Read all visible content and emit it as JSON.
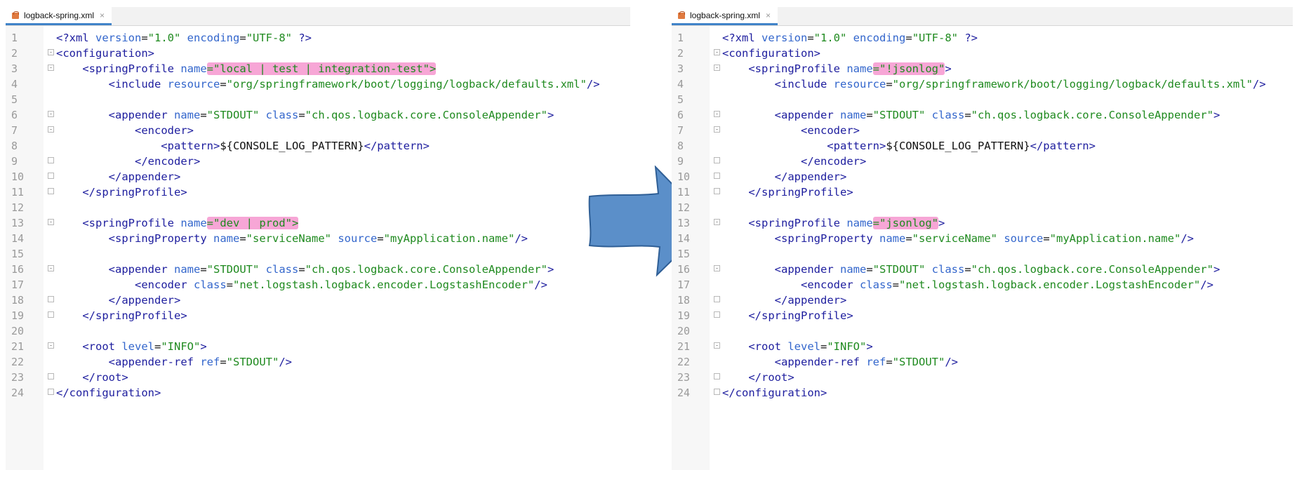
{
  "left_panel": {
    "tab": {
      "filename": "logback-spring.xml",
      "close": "×"
    },
    "lines": [
      [
        {
          "t": "<?",
          "c": "tg"
        },
        {
          "t": "xml",
          "c": "tg"
        },
        {
          "t": " version",
          "c": "at"
        },
        {
          "t": "=",
          "c": "tx"
        },
        {
          "t": "\"1.0\"",
          "c": "vl"
        },
        {
          "t": " encoding",
          "c": "at"
        },
        {
          "t": "=",
          "c": "tx"
        },
        {
          "t": "\"UTF-8\"",
          "c": "vl"
        },
        {
          "t": " ?>",
          "c": "tg"
        }
      ],
      [
        {
          "t": "<",
          "c": "tg"
        },
        {
          "t": "configuration",
          "c": "tg"
        },
        {
          "t": ">",
          "c": "tg"
        }
      ],
      [
        {
          "t": "    <",
          "c": "tg"
        },
        {
          "t": "springProfile",
          "c": "tg"
        },
        {
          "t": " name",
          "c": "at"
        },
        {
          "t": "=\"local | test | integration-test\">",
          "c": "vl",
          "hl": true
        }
      ],
      [
        {
          "t": "        <",
          "c": "tg"
        },
        {
          "t": "include",
          "c": "tg"
        },
        {
          "t": " resource",
          "c": "at"
        },
        {
          "t": "=",
          "c": "tx"
        },
        {
          "t": "\"org/springframework/boot/logging/logback/defaults.xml\"",
          "c": "vl"
        },
        {
          "t": "/>",
          "c": "tg"
        }
      ],
      [],
      [
        {
          "t": "        <",
          "c": "tg"
        },
        {
          "t": "appender",
          "c": "tg"
        },
        {
          "t": " name",
          "c": "at"
        },
        {
          "t": "=",
          "c": "tx"
        },
        {
          "t": "\"STDOUT\"",
          "c": "vl"
        },
        {
          "t": " class",
          "c": "at"
        },
        {
          "t": "=",
          "c": "tx"
        },
        {
          "t": "\"ch.qos.logback.core.ConsoleAppender\"",
          "c": "vl"
        },
        {
          "t": ">",
          "c": "tg"
        }
      ],
      [
        {
          "t": "            <",
          "c": "tg"
        },
        {
          "t": "encoder",
          "c": "tg"
        },
        {
          "t": ">",
          "c": "tg"
        }
      ],
      [
        {
          "t": "                <",
          "c": "tg"
        },
        {
          "t": "pattern",
          "c": "tg"
        },
        {
          "t": ">",
          "c": "tg"
        },
        {
          "t": "${CONSOLE_LOG_PATTERN}",
          "c": "tx"
        },
        {
          "t": "</",
          "c": "tg"
        },
        {
          "t": "pattern",
          "c": "tg"
        },
        {
          "t": ">",
          "c": "tg"
        }
      ],
      [
        {
          "t": "            </",
          "c": "tg"
        },
        {
          "t": "encoder",
          "c": "tg"
        },
        {
          "t": ">",
          "c": "tg"
        }
      ],
      [
        {
          "t": "        </",
          "c": "tg"
        },
        {
          "t": "appender",
          "c": "tg"
        },
        {
          "t": ">",
          "c": "tg"
        }
      ],
      [
        {
          "t": "    </",
          "c": "tg"
        },
        {
          "t": "springProfile",
          "c": "tg"
        },
        {
          "t": ">",
          "c": "tg"
        }
      ],
      [],
      [
        {
          "t": "    <",
          "c": "tg"
        },
        {
          "t": "springProfile",
          "c": "tg"
        },
        {
          "t": " name",
          "c": "at"
        },
        {
          "t": "=\"dev | prod\">",
          "c": "vl",
          "hl": true
        }
      ],
      [
        {
          "t": "        <",
          "c": "tg"
        },
        {
          "t": "springProperty",
          "c": "tg"
        },
        {
          "t": " name",
          "c": "at"
        },
        {
          "t": "=",
          "c": "tx"
        },
        {
          "t": "\"serviceName\"",
          "c": "vl"
        },
        {
          "t": " source",
          "c": "at"
        },
        {
          "t": "=",
          "c": "tx"
        },
        {
          "t": "\"myApplication.name\"",
          "c": "vl"
        },
        {
          "t": "/>",
          "c": "tg"
        }
      ],
      [],
      [
        {
          "t": "        <",
          "c": "tg"
        },
        {
          "t": "appender",
          "c": "tg"
        },
        {
          "t": " name",
          "c": "at"
        },
        {
          "t": "=",
          "c": "tx"
        },
        {
          "t": "\"STDOUT\"",
          "c": "vl"
        },
        {
          "t": " class",
          "c": "at"
        },
        {
          "t": "=",
          "c": "tx"
        },
        {
          "t": "\"ch.qos.logback.core.ConsoleAppender\"",
          "c": "vl"
        },
        {
          "t": ">",
          "c": "tg"
        }
      ],
      [
        {
          "t": "            <",
          "c": "tg"
        },
        {
          "t": "encoder",
          "c": "tg"
        },
        {
          "t": " class",
          "c": "at"
        },
        {
          "t": "=",
          "c": "tx"
        },
        {
          "t": "\"net.logstash.logback.encoder.LogstashEncoder\"",
          "c": "vl"
        },
        {
          "t": "/>",
          "c": "tg"
        }
      ],
      [
        {
          "t": "        </",
          "c": "tg"
        },
        {
          "t": "appender",
          "c": "tg"
        },
        {
          "t": ">",
          "c": "tg"
        }
      ],
      [
        {
          "t": "    </",
          "c": "tg"
        },
        {
          "t": "springProfile",
          "c": "tg"
        },
        {
          "t": ">",
          "c": "tg"
        }
      ],
      [],
      [
        {
          "t": "    <",
          "c": "tg"
        },
        {
          "t": "root",
          "c": "tg"
        },
        {
          "t": " level",
          "c": "at"
        },
        {
          "t": "=",
          "c": "tx"
        },
        {
          "t": "\"INFO\"",
          "c": "vl"
        },
        {
          "t": ">",
          "c": "tg"
        }
      ],
      [
        {
          "t": "        <",
          "c": "tg"
        },
        {
          "t": "appender-ref",
          "c": "tg"
        },
        {
          "t": " ref",
          "c": "at"
        },
        {
          "t": "=",
          "c": "tx"
        },
        {
          "t": "\"STDOUT\"",
          "c": "vl"
        },
        {
          "t": "/>",
          "c": "tg"
        }
      ],
      [
        {
          "t": "    </",
          "c": "tg"
        },
        {
          "t": "root",
          "c": "tg"
        },
        {
          "t": ">",
          "c": "tg"
        }
      ],
      [
        {
          "t": "</",
          "c": "tg"
        },
        {
          "t": "configuration",
          "c": "tg"
        },
        {
          "t": ">",
          "c": "tg"
        }
      ]
    ]
  },
  "right_panel": {
    "tab": {
      "filename": "logback-spring.xml",
      "close": "×"
    },
    "lines": [
      [
        {
          "t": "<?",
          "c": "tg"
        },
        {
          "t": "xml",
          "c": "tg"
        },
        {
          "t": " version",
          "c": "at"
        },
        {
          "t": "=",
          "c": "tx"
        },
        {
          "t": "\"1.0\"",
          "c": "vl"
        },
        {
          "t": " encoding",
          "c": "at"
        },
        {
          "t": "=",
          "c": "tx"
        },
        {
          "t": "\"UTF-8\"",
          "c": "vl"
        },
        {
          "t": " ?>",
          "c": "tg"
        }
      ],
      [
        {
          "t": "<",
          "c": "tg"
        },
        {
          "t": "configuration",
          "c": "tg"
        },
        {
          "t": ">",
          "c": "tg"
        }
      ],
      [
        {
          "t": "    <",
          "c": "tg"
        },
        {
          "t": "springProfile",
          "c": "tg"
        },
        {
          "t": " name",
          "c": "at"
        },
        {
          "t": "=\"!jsonlog\"",
          "c": "vl",
          "hl": true
        },
        {
          "t": ">",
          "c": "tg"
        }
      ],
      [
        {
          "t": "        <",
          "c": "tg"
        },
        {
          "t": "include",
          "c": "tg"
        },
        {
          "t": " resource",
          "c": "at"
        },
        {
          "t": "=",
          "c": "tx"
        },
        {
          "t": "\"org/springframework/boot/logging/logback/defaults.xml\"",
          "c": "vl"
        },
        {
          "t": "/>",
          "c": "tg"
        }
      ],
      [],
      [
        {
          "t": "        <",
          "c": "tg"
        },
        {
          "t": "appender",
          "c": "tg"
        },
        {
          "t": " name",
          "c": "at"
        },
        {
          "t": "=",
          "c": "tx"
        },
        {
          "t": "\"STDOUT\"",
          "c": "vl"
        },
        {
          "t": " class",
          "c": "at"
        },
        {
          "t": "=",
          "c": "tx"
        },
        {
          "t": "\"ch.qos.logback.core.ConsoleAppender\"",
          "c": "vl"
        },
        {
          "t": ">",
          "c": "tg"
        }
      ],
      [
        {
          "t": "            <",
          "c": "tg"
        },
        {
          "t": "encoder",
          "c": "tg"
        },
        {
          "t": ">",
          "c": "tg"
        }
      ],
      [
        {
          "t": "                <",
          "c": "tg"
        },
        {
          "t": "pattern",
          "c": "tg"
        },
        {
          "t": ">",
          "c": "tg"
        },
        {
          "t": "${CONSOLE_LOG_PATTERN}",
          "c": "tx"
        },
        {
          "t": "</",
          "c": "tg"
        },
        {
          "t": "pattern",
          "c": "tg"
        },
        {
          "t": ">",
          "c": "tg"
        }
      ],
      [
        {
          "t": "            </",
          "c": "tg"
        },
        {
          "t": "encoder",
          "c": "tg"
        },
        {
          "t": ">",
          "c": "tg"
        }
      ],
      [
        {
          "t": "        </",
          "c": "tg"
        },
        {
          "t": "appender",
          "c": "tg"
        },
        {
          "t": ">",
          "c": "tg"
        }
      ],
      [
        {
          "t": "    </",
          "c": "tg"
        },
        {
          "t": "springProfile",
          "c": "tg"
        },
        {
          "t": ">",
          "c": "tg"
        }
      ],
      [],
      [
        {
          "t": "    <",
          "c": "tg"
        },
        {
          "t": "springProfile",
          "c": "tg"
        },
        {
          "t": " name",
          "c": "at"
        },
        {
          "t": "=\"jsonlog\"",
          "c": "vl",
          "hl": true
        },
        {
          "t": ">",
          "c": "tg"
        }
      ],
      [
        {
          "t": "        <",
          "c": "tg"
        },
        {
          "t": "springProperty",
          "c": "tg"
        },
        {
          "t": " name",
          "c": "at"
        },
        {
          "t": "=",
          "c": "tx"
        },
        {
          "t": "\"serviceName\"",
          "c": "vl"
        },
        {
          "t": " source",
          "c": "at"
        },
        {
          "t": "=",
          "c": "tx"
        },
        {
          "t": "\"myApplication.name\"",
          "c": "vl"
        },
        {
          "t": "/>",
          "c": "tg"
        }
      ],
      [],
      [
        {
          "t": "        <",
          "c": "tg"
        },
        {
          "t": "appender",
          "c": "tg"
        },
        {
          "t": " name",
          "c": "at"
        },
        {
          "t": "=",
          "c": "tx"
        },
        {
          "t": "\"STDOUT\"",
          "c": "vl"
        },
        {
          "t": " class",
          "c": "at"
        },
        {
          "t": "=",
          "c": "tx"
        },
        {
          "t": "\"ch.qos.logback.core.ConsoleAppender\"",
          "c": "vl"
        },
        {
          "t": ">",
          "c": "tg"
        }
      ],
      [
        {
          "t": "            <",
          "c": "tg"
        },
        {
          "t": "encoder",
          "c": "tg"
        },
        {
          "t": " class",
          "c": "at"
        },
        {
          "t": "=",
          "c": "tx"
        },
        {
          "t": "\"net.logstash.logback.encoder.LogstashEncoder\"",
          "c": "vl"
        },
        {
          "t": "/>",
          "c": "tg"
        }
      ],
      [
        {
          "t": "        </",
          "c": "tg"
        },
        {
          "t": "appender",
          "c": "tg"
        },
        {
          "t": ">",
          "c": "tg"
        }
      ],
      [
        {
          "t": "    </",
          "c": "tg"
        },
        {
          "t": "springProfile",
          "c": "tg"
        },
        {
          "t": ">",
          "c": "tg"
        }
      ],
      [],
      [
        {
          "t": "    <",
          "c": "tg"
        },
        {
          "t": "root",
          "c": "tg"
        },
        {
          "t": " level",
          "c": "at"
        },
        {
          "t": "=",
          "c": "tx"
        },
        {
          "t": "\"INFO\"",
          "c": "vl"
        },
        {
          "t": ">",
          "c": "tg"
        }
      ],
      [
        {
          "t": "        <",
          "c": "tg"
        },
        {
          "t": "appender-ref",
          "c": "tg"
        },
        {
          "t": " ref",
          "c": "at"
        },
        {
          "t": "=",
          "c": "tx"
        },
        {
          "t": "\"STDOUT\"",
          "c": "vl"
        },
        {
          "t": "/>",
          "c": "tg"
        }
      ],
      [
        {
          "t": "    </",
          "c": "tg"
        },
        {
          "t": "root",
          "c": "tg"
        },
        {
          "t": ">",
          "c": "tg"
        }
      ],
      [
        {
          "t": "</",
          "c": "tg"
        },
        {
          "t": "configuration",
          "c": "tg"
        },
        {
          "t": ">",
          "c": "tg"
        }
      ]
    ]
  },
  "line_numbers": [
    "1",
    "2",
    "3",
    "4",
    "5",
    "6",
    "7",
    "8",
    "9",
    "10",
    "11",
    "12",
    "13",
    "14",
    "15",
    "16",
    "17",
    "18",
    "19",
    "20",
    "21",
    "22",
    "23",
    "24"
  ],
  "fold_markers": {
    "2": "open",
    "3": "open",
    "6": "open",
    "7": "open",
    "9": "end",
    "10": "end",
    "11": "end",
    "13": "open",
    "16": "open",
    "18": "end",
    "19": "end",
    "21": "open",
    "23": "end",
    "24": "end"
  },
  "colors": {
    "highlight": "#f7a6d6",
    "arrow_fill": "#5b8fc9",
    "arrow_stroke": "#2f5f96"
  },
  "arrow_icon": "right-arrow-icon"
}
